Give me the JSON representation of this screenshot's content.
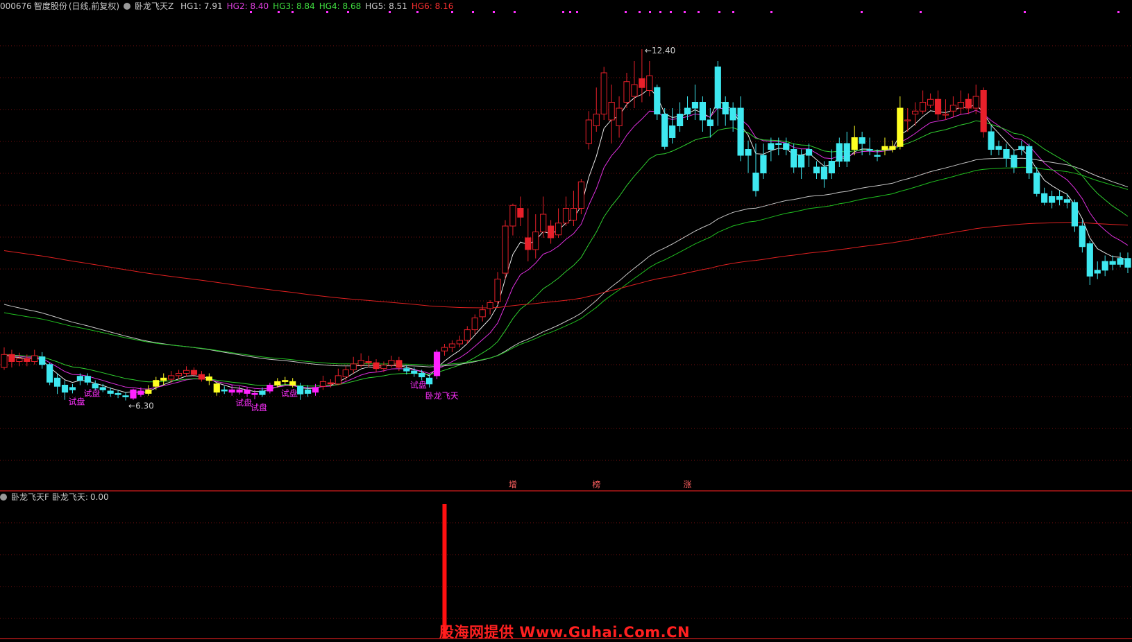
{
  "top_header": {
    "code": "000676",
    "name": "智度股份",
    "period": "(日线,前复权)",
    "indicator": "卧龙飞天Z",
    "hg": [
      {
        "label": "HG1:",
        "value": "7.91",
        "color": "#d0d0d0"
      },
      {
        "label": "HG2:",
        "value": "8.40",
        "color": "#e040e0"
      },
      {
        "label": "HG3:",
        "value": "8.84",
        "color": "#40e040"
      },
      {
        "label": "HG4:",
        "value": "8.68",
        "color": "#40e040"
      },
      {
        "label": "HG5:",
        "value": "8.51",
        "color": "#d0d0d0"
      },
      {
        "label": "HG6:",
        "value": "8.16",
        "color": "#ff3030"
      }
    ]
  },
  "sub_header": {
    "indicator": "卧龙飞天F",
    "label": "卧龙飞天:",
    "value": "0.00"
  },
  "watermark": "股海网提供 Www.Guhai.Com.CN",
  "chart_data": {
    "type": "candlestick",
    "price_range": [
      5.0,
      13.0
    ],
    "high_label": "12.40",
    "low_label": "6.30",
    "signal_labels": [
      {
        "text": "试盘",
        "bar": 9
      },
      {
        "text": "试盘",
        "bar": 11
      },
      {
        "text": "试盘",
        "bar": 31
      },
      {
        "text": "试盘",
        "bar": 33
      },
      {
        "text": "试盘",
        "bar": 37
      },
      {
        "text": "试盘",
        "bar": 54
      },
      {
        "text": "卧龙飞天",
        "bar": 56
      }
    ],
    "bottom_markers": [
      {
        "text": "增",
        "bar": 67
      },
      {
        "text": "榜",
        "bar": 78
      },
      {
        "text": "涨",
        "bar": 90
      }
    ],
    "sub_signal": {
      "bar": 58,
      "value": 1
    },
    "candles": [
      [
        7.0,
        7.22,
        7.34,
        6.96,
        "red"
      ],
      [
        7.22,
        7.1,
        7.3,
        7.0,
        "red"
      ],
      [
        7.1,
        7.15,
        7.25,
        7.02,
        "red"
      ],
      [
        7.15,
        7.1,
        7.22,
        7.02,
        "red"
      ],
      [
        7.1,
        7.2,
        7.3,
        7.05,
        "red"
      ],
      [
        7.18,
        7.05,
        7.26,
        6.98,
        "cyan"
      ],
      [
        7.05,
        6.75,
        7.08,
        6.7,
        "cyan"
      ],
      [
        6.82,
        6.68,
        6.9,
        6.55,
        "cyan"
      ],
      [
        6.7,
        6.58,
        6.78,
        6.45,
        "cyan"
      ],
      [
        6.62,
        6.66,
        6.72,
        6.56,
        "cyan"
      ],
      [
        6.78,
        6.85,
        6.9,
        6.7,
        "cyan"
      ],
      [
        6.85,
        6.75,
        6.9,
        6.7,
        "cyan"
      ],
      [
        6.72,
        6.65,
        6.78,
        6.62,
        "cyan"
      ],
      [
        6.66,
        6.62,
        6.72,
        6.58,
        "cyan"
      ],
      [
        6.6,
        6.56,
        6.66,
        6.5,
        "cyan"
      ],
      [
        6.56,
        6.54,
        6.62,
        6.48,
        "cyan"
      ],
      [
        6.52,
        6.5,
        6.58,
        6.44,
        "cyan"
      ],
      [
        6.48,
        6.62,
        6.64,
        6.45,
        "magenta"
      ],
      [
        6.6,
        6.54,
        6.66,
        6.5,
        "magenta"
      ],
      [
        6.56,
        6.62,
        6.7,
        6.52,
        "yellow"
      ],
      [
        6.68,
        6.78,
        6.84,
        6.62,
        "yellow"
      ],
      [
        6.78,
        6.82,
        6.9,
        6.7,
        "yellow"
      ],
      [
        6.8,
        6.86,
        6.94,
        6.74,
        "red"
      ],
      [
        6.86,
        6.9,
        6.96,
        6.8,
        "red"
      ],
      [
        6.9,
        6.95,
        7.02,
        6.84,
        "red"
      ],
      [
        6.95,
        6.88,
        7.0,
        6.84,
        "red"
      ],
      [
        6.88,
        6.8,
        6.94,
        6.76,
        "red"
      ],
      [
        6.84,
        6.78,
        6.9,
        6.7,
        "yellow"
      ],
      [
        6.72,
        6.58,
        6.74,
        6.52,
        "yellow"
      ],
      [
        6.6,
        6.62,
        6.68,
        6.55,
        "cyan"
      ],
      [
        6.62,
        6.58,
        6.7,
        6.52,
        "magenta"
      ],
      [
        6.58,
        6.62,
        6.68,
        6.54,
        "magenta"
      ],
      [
        6.62,
        6.56,
        6.66,
        6.5,
        "magenta"
      ],
      [
        6.56,
        6.54,
        6.62,
        6.46,
        "magenta"
      ],
      [
        6.54,
        6.6,
        6.66,
        6.5,
        "cyan"
      ],
      [
        6.6,
        6.7,
        6.74,
        6.56,
        "magenta"
      ],
      [
        6.7,
        6.76,
        6.82,
        6.66,
        "yellow"
      ],
      [
        6.76,
        6.78,
        6.84,
        6.7,
        "yellow"
      ],
      [
        6.76,
        6.7,
        6.82,
        6.66,
        "yellow"
      ],
      [
        6.68,
        6.55,
        6.74,
        6.45,
        "cyan"
      ],
      [
        6.56,
        6.62,
        6.7,
        6.5,
        "cyan"
      ],
      [
        6.58,
        6.66,
        6.72,
        6.52,
        "magenta"
      ],
      [
        6.68,
        6.76,
        6.86,
        6.62,
        "red"
      ],
      [
        6.74,
        6.72,
        6.8,
        6.66,
        "red"
      ],
      [
        6.72,
        6.86,
        6.98,
        6.7,
        "red"
      ],
      [
        6.84,
        6.96,
        7.02,
        6.78,
        "red"
      ],
      [
        6.96,
        7.06,
        7.18,
        6.9,
        "red"
      ],
      [
        7.04,
        7.12,
        7.24,
        7.0,
        "red"
      ],
      [
        7.1,
        7.08,
        7.2,
        7.0,
        "red"
      ],
      [
        7.08,
        6.98,
        7.14,
        6.92,
        "red"
      ],
      [
        6.98,
        7.04,
        7.1,
        6.92,
        "red"
      ],
      [
        7.04,
        7.12,
        7.2,
        7.0,
        "red"
      ],
      [
        7.12,
        7.0,
        7.18,
        6.94,
        "red"
      ],
      [
        6.98,
        6.94,
        7.04,
        6.88,
        "cyan"
      ],
      [
        6.94,
        6.9,
        7.0,
        6.84,
        "cyan"
      ],
      [
        6.9,
        6.84,
        6.96,
        6.78,
        "cyan"
      ],
      [
        6.82,
        6.72,
        6.88,
        6.66,
        "cyan"
      ],
      [
        6.86,
        7.26,
        7.3,
        6.8,
        "magenta"
      ],
      [
        7.28,
        7.34,
        7.4,
        7.2,
        "red"
      ],
      [
        7.34,
        7.4,
        7.46,
        7.26,
        "red"
      ],
      [
        7.4,
        7.46,
        7.54,
        7.34,
        "red"
      ],
      [
        7.46,
        7.64,
        7.7,
        7.4,
        "red"
      ],
      [
        7.64,
        7.84,
        7.9,
        7.56,
        "red"
      ],
      [
        7.86,
        7.98,
        8.06,
        7.78,
        "red"
      ],
      [
        8.0,
        8.1,
        8.14,
        7.9,
        "red"
      ],
      [
        8.12,
        8.5,
        8.62,
        8.06,
        "red"
      ],
      [
        8.6,
        9.4,
        9.5,
        8.5,
        "red"
      ],
      [
        9.4,
        9.75,
        9.78,
        9.24,
        "red"
      ],
      [
        9.7,
        9.55,
        9.9,
        9.4,
        "red"
      ],
      [
        9.2,
        9.0,
        9.7,
        8.8,
        "red"
      ],
      [
        9.0,
        9.3,
        9.6,
        8.85,
        "red"
      ],
      [
        9.3,
        9.6,
        9.9,
        9.2,
        "red"
      ],
      [
        9.4,
        9.2,
        9.5,
        9.1,
        "red"
      ],
      [
        9.25,
        9.45,
        9.7,
        9.2,
        "red"
      ],
      [
        9.45,
        9.7,
        9.9,
        9.4,
        "red"
      ],
      [
        9.5,
        9.7,
        10.0,
        9.4,
        "red"
      ],
      [
        9.7,
        10.15,
        10.2,
        9.6,
        "red"
      ],
      [
        10.8,
        11.2,
        11.35,
        10.7,
        "red"
      ],
      [
        11.1,
        11.3,
        11.75,
        11.0,
        "red"
      ],
      [
        11.3,
        12.0,
        12.1,
        11.2,
        "red"
      ],
      [
        11.2,
        11.5,
        11.8,
        10.8,
        "red"
      ],
      [
        11.1,
        11.4,
        11.6,
        10.9,
        "red"
      ],
      [
        11.5,
        11.85,
        12.0,
        11.4,
        "red"
      ],
      [
        11.6,
        11.8,
        12.2,
        11.4,
        "red"
      ],
      [
        11.9,
        11.75,
        12.4,
        11.5,
        "red"
      ],
      [
        11.7,
        11.95,
        12.2,
        11.6,
        "red"
      ],
      [
        11.75,
        11.3,
        11.8,
        11.2,
        "cyan"
      ],
      [
        11.3,
        10.75,
        11.4,
        10.7,
        "cyan"
      ],
      [
        10.9,
        11.1,
        11.4,
        10.8,
        "cyan"
      ],
      [
        11.1,
        11.3,
        11.5,
        11.0,
        "cyan"
      ],
      [
        11.3,
        11.4,
        11.6,
        11.2,
        "cyan"
      ],
      [
        11.4,
        11.5,
        11.8,
        11.2,
        "cyan"
      ],
      [
        11.5,
        11.2,
        11.6,
        11.0,
        "cyan"
      ],
      [
        11.2,
        11.1,
        11.4,
        10.9,
        "cyan"
      ],
      [
        11.4,
        12.1,
        12.2,
        11.1,
        "cyan"
      ],
      [
        11.5,
        11.3,
        11.6,
        11.1,
        "cyan"
      ],
      [
        11.4,
        11.2,
        11.5,
        11.0,
        "cyan"
      ],
      [
        11.4,
        10.6,
        11.6,
        10.5,
        "cyan"
      ],
      [
        10.7,
        10.6,
        10.85,
        10.3,
        "cyan"
      ],
      [
        10.3,
        10.0,
        10.8,
        9.9,
        "cyan"
      ],
      [
        10.3,
        10.6,
        10.8,
        10.2,
        "cyan"
      ],
      [
        10.7,
        10.8,
        10.9,
        10.5,
        "cyan"
      ],
      [
        10.8,
        10.8,
        10.9,
        10.6,
        "cyan"
      ],
      [
        10.8,
        10.7,
        10.9,
        10.6,
        "cyan"
      ],
      [
        10.7,
        10.4,
        10.8,
        10.3,
        "cyan"
      ],
      [
        10.4,
        10.6,
        10.7,
        10.2,
        "cyan"
      ],
      [
        10.6,
        10.7,
        10.8,
        10.4,
        "cyan"
      ],
      [
        10.4,
        10.3,
        10.5,
        10.2,
        "cyan"
      ],
      [
        10.4,
        10.2,
        10.5,
        10.05,
        "cyan"
      ],
      [
        10.3,
        10.5,
        10.7,
        10.2,
        "cyan"
      ],
      [
        10.5,
        10.8,
        10.9,
        10.4,
        "cyan"
      ],
      [
        10.8,
        10.5,
        11.0,
        10.4,
        "cyan"
      ],
      [
        10.7,
        10.9,
        11.1,
        10.6,
        "yellow"
      ],
      [
        10.9,
        10.8,
        11.0,
        10.6,
        "cyan"
      ],
      [
        10.7,
        10.7,
        10.9,
        10.6,
        "cyan"
      ],
      [
        10.6,
        10.6,
        10.7,
        10.5,
        "cyan"
      ],
      [
        10.7,
        10.75,
        10.9,
        10.6,
        "yellow"
      ],
      [
        10.7,
        10.75,
        10.85,
        10.65,
        "yellow"
      ],
      [
        10.75,
        11.4,
        11.6,
        10.7,
        "yellow"
      ],
      [
        11.2,
        11.2,
        11.4,
        11.0,
        "red"
      ],
      [
        11.3,
        11.35,
        11.5,
        11.1,
        "red"
      ],
      [
        11.35,
        11.5,
        11.7,
        11.3,
        "red"
      ],
      [
        11.45,
        11.55,
        11.65,
        11.4,
        "red"
      ],
      [
        11.55,
        11.3,
        11.7,
        11.2,
        "red"
      ],
      [
        11.3,
        11.3,
        11.55,
        11.2,
        "red"
      ],
      [
        11.35,
        11.45,
        11.6,
        11.25,
        "red"
      ],
      [
        11.4,
        11.5,
        11.7,
        11.3,
        "red"
      ],
      [
        11.55,
        11.4,
        11.65,
        11.3,
        "red"
      ],
      [
        11.4,
        11.6,
        11.8,
        11.3,
        "red"
      ],
      [
        11.7,
        11.0,
        11.75,
        10.9,
        "red"
      ],
      [
        11.0,
        10.7,
        11.1,
        10.6,
        "cyan"
      ],
      [
        10.75,
        10.7,
        10.85,
        10.6,
        "cyan"
      ],
      [
        10.7,
        10.55,
        10.8,
        10.4,
        "cyan"
      ],
      [
        10.6,
        10.4,
        10.7,
        10.3,
        "cyan"
      ],
      [
        10.7,
        10.75,
        10.85,
        10.6,
        "cyan"
      ],
      [
        10.75,
        10.3,
        10.8,
        10.2,
        "cyan"
      ],
      [
        10.3,
        9.95,
        10.4,
        9.9,
        "cyan"
      ],
      [
        9.95,
        9.8,
        10.05,
        9.75,
        "cyan"
      ],
      [
        9.8,
        9.9,
        10.0,
        9.7,
        "cyan"
      ],
      [
        9.9,
        9.85,
        10.0,
        9.75,
        "cyan"
      ],
      [
        9.85,
        9.8,
        9.95,
        9.7,
        "cyan"
      ],
      [
        9.8,
        9.4,
        9.85,
        9.3,
        "cyan"
      ],
      [
        9.4,
        9.05,
        9.5,
        8.95,
        "cyan"
      ],
      [
        9.1,
        8.55,
        9.15,
        8.4,
        "cyan"
      ],
      [
        8.6,
        8.65,
        8.8,
        8.5,
        "cyan"
      ],
      [
        8.65,
        8.8,
        8.9,
        8.55,
        "cyan"
      ],
      [
        8.8,
        8.75,
        8.9,
        8.65,
        "cyan"
      ],
      [
        8.75,
        8.85,
        8.95,
        8.7,
        "cyan"
      ],
      [
        8.85,
        8.7,
        8.95,
        8.6,
        "cyan"
      ]
    ]
  }
}
